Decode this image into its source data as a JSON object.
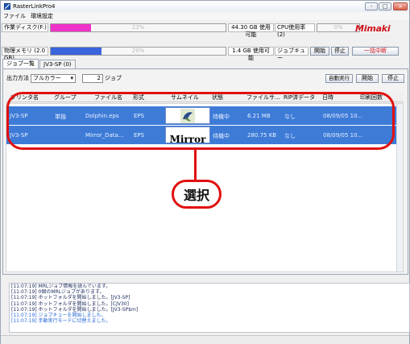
{
  "window": {
    "title": "RasterLinkPro4",
    "controls": [
      "-",
      "□",
      "×"
    ]
  },
  "menu": [
    "ファイル",
    "環境設定"
  ],
  "disk": {
    "label": "作業ディスク(F:)",
    "percent": 23,
    "percent_text": "23%",
    "color": "#f032c8",
    "available": "44.30 GB 使用可能"
  },
  "memory": {
    "label": "物理メモリ (2.0 GB)",
    "percent": 29,
    "percent_text": "29%",
    "color": "#3a64dc",
    "available": "1.4 GB 使用可能"
  },
  "cpu": {
    "label": "CPU使用率 (2)",
    "percent_text": "0%"
  },
  "queue": {
    "label": "ジョブキュー",
    "start": "開始",
    "stop": "停止",
    "abort": "一括中断"
  },
  "logo": "Mimaki",
  "tabs": [
    "ジョブ一覧",
    "JV3-SP (0)"
  ],
  "toolbar": {
    "output_label": "出力方法",
    "output_value": "フルカラー",
    "count": "2",
    "count_unit": "ジョブ",
    "auto_label": "自動実行",
    "start": "開始",
    "stop": "停止"
  },
  "columns": {
    "printer": "プリンタ名",
    "group": "グループ",
    "file": "ファイル名",
    "format": "形式",
    "thumb": "サムネイル",
    "status": "状態",
    "size": "ファイルサ...",
    "rip": "RIP済データ",
    "date": "日時",
    "copies": "印刷回数"
  },
  "rows": [
    {
      "printer": "JV3-SP",
      "group": "単独",
      "file": "Dolphin.eps",
      "format": "EPS",
      "thumb": "dolphin-image",
      "status": "待機中",
      "size": "6.21 MB",
      "rip": "なし",
      "date": "08/09/05 10..."
    },
    {
      "printer": "JV3-SP",
      "group": "",
      "file": "Mirror_Data...",
      "format": "EPS",
      "thumb": "Mirror",
      "status": "待機中",
      "size": "280.75 KB",
      "rip": "なし",
      "date": "08/09/05 10..."
    }
  ],
  "log": [
    "[11:07:19] MRLジョブ情報を読んでいます。",
    "[11:07:19] 0個のMRLジョブがあります。",
    "[11:07:19] ホットフォルダを開始しました。[JV3-SP]",
    "[11:07:19] ホットフォルダを開始しました。[CJV30]",
    "[11:07:19] ホットフォルダを開始しました。[JV3-SP$m]",
    "[11:07:19] ジョブキューを開始しました。",
    "[11:07:19] 手動実行モードに切替えました。"
  ],
  "callout": "選択",
  "colors": {
    "selection": "#3d7bd7",
    "annotation": "#e01010"
  }
}
